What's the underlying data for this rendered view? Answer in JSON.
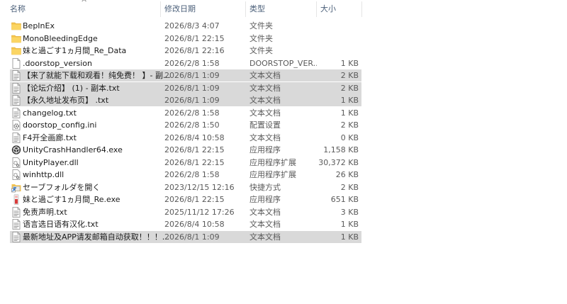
{
  "columns": {
    "name": "名称",
    "date": "修改日期",
    "type": "类型",
    "size": "大小"
  },
  "files": [
    {
      "name": "BepInEx",
      "date": "2026/8/3 4:07",
      "type": "文件夹",
      "size": "",
      "icon": "folder-icon",
      "selected": false
    },
    {
      "name": "MonoBleedingEdge",
      "date": "2026/8/1 22:15",
      "type": "文件夹",
      "size": "",
      "icon": "folder-icon",
      "selected": false
    },
    {
      "name": "妹と過ごす1ヵ月間_Re_Data",
      "date": "2026/8/1 22:16",
      "type": "文件夹",
      "size": "",
      "icon": "folder-icon",
      "selected": false
    },
    {
      "name": ".doorstop_version",
      "date": "2026/2/8 1:58",
      "type": "DOORSTOP_VER...",
      "size": "1 KB",
      "icon": "blank-file-icon",
      "selected": false
    },
    {
      "name": "【来了就能下载和观看！纯免费！ 】- 副...",
      "date": "2026/8/1 1:09",
      "type": "文本文档",
      "size": "2 KB",
      "icon": "text-file-icon",
      "selected": true
    },
    {
      "name": "【论坛介绍】 (1) - 副本.txt",
      "date": "2026/8/1 1:09",
      "type": "文本文档",
      "size": "2 KB",
      "icon": "text-file-icon",
      "selected": true
    },
    {
      "name": "【永久地址发布页】 .txt",
      "date": "2026/8/1 1:09",
      "type": "文本文档",
      "size": "1 KB",
      "icon": "text-file-icon",
      "selected": true
    },
    {
      "name": "changelog.txt",
      "date": "2026/2/8 1:58",
      "type": "文本文档",
      "size": "1 KB",
      "icon": "text-file-icon",
      "selected": false
    },
    {
      "name": "doorstop_config.ini",
      "date": "2026/2/8 1:50",
      "type": "配置设置",
      "size": "2 KB",
      "icon": "config-file-icon",
      "selected": false
    },
    {
      "name": "F4开全画廊.txt",
      "date": "2026/8/4 10:58",
      "type": "文本文档",
      "size": "0 KB",
      "icon": "text-file-icon",
      "selected": false
    },
    {
      "name": "UnityCrashHandler64.exe",
      "date": "2026/8/1 22:15",
      "type": "应用程序",
      "size": "1,158 KB",
      "icon": "unity-exe-icon",
      "selected": false
    },
    {
      "name": "UnityPlayer.dll",
      "date": "2026/8/1 22:15",
      "type": "应用程序扩展",
      "size": "30,372 KB",
      "icon": "dll-file-icon",
      "selected": false
    },
    {
      "name": "winhttp.dll",
      "date": "2026/2/8 1:58",
      "type": "应用程序扩展",
      "size": "26 KB",
      "icon": "dll-file-icon",
      "selected": false
    },
    {
      "name": "セーブフォルダを開く",
      "date": "2023/12/15 12:16",
      "type": "快捷方式",
      "size": "2 KB",
      "icon": "shortcut-icon",
      "selected": false
    },
    {
      "name": "妹と過ごす1ヵ月間_Re.exe",
      "date": "2026/8/1 22:15",
      "type": "应用程序",
      "size": "651 KB",
      "icon": "game-exe-icon",
      "selected": false
    },
    {
      "name": "免责声明.txt",
      "date": "2025/11/12 17:26",
      "type": "文本文档",
      "size": "3 KB",
      "icon": "text-file-icon",
      "selected": false
    },
    {
      "name": "语言选日语有汉化.txt",
      "date": "2026/8/4 10:58",
      "type": "文本文档",
      "size": "1 KB",
      "icon": "text-file-icon",
      "selected": false
    },
    {
      "name": "最新地址及APP请发邮箱自动获取！！！...",
      "date": "2026/8/1 1:09",
      "type": "文本文档",
      "size": "1 KB",
      "icon": "text-file-icon",
      "selected": true
    }
  ]
}
